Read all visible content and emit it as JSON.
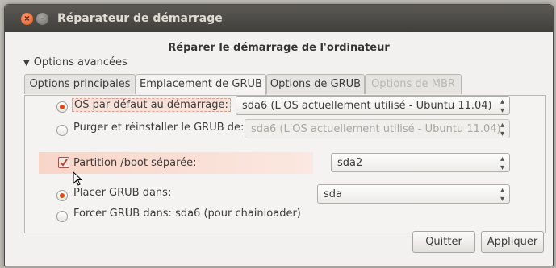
{
  "window": {
    "title": "Réparateur de démarrage"
  },
  "heading": "Réparer le démarrage de l'ordinateur",
  "expander": {
    "label": "Options avancées"
  },
  "tabs": [
    {
      "label": "Options principales",
      "state": "normal"
    },
    {
      "label": "Emplacement de GRUB",
      "state": "active"
    },
    {
      "label": "Options de GRUB",
      "state": "normal"
    },
    {
      "label": "Options de MBR",
      "state": "disabled"
    }
  ],
  "options": {
    "default_os": {
      "label": "OS par défaut au démarrage:",
      "selected": true,
      "value": "sda6 (L'OS actuellement utilisé - Ubuntu 11.04)"
    },
    "purge_grub": {
      "label": "Purger et réinstaller le GRUB de:",
      "selected": false,
      "value": "sda6 (L'OS actuellement utilisé - Ubuntu 11.04)"
    },
    "separate_boot": {
      "label": "Partition /boot séparée:",
      "checked": true,
      "value": "sda2"
    },
    "place_grub": {
      "label": "Placer GRUB dans:",
      "selected": true,
      "value": "sda"
    },
    "force_grub": {
      "label": "Forcer GRUB dans: sda6 (pour chainloader)",
      "selected": false
    }
  },
  "buttons": {
    "quit": "Quitter",
    "apply": "Appliquer"
  },
  "colors": {
    "accent": "#dd4814",
    "titlebar": "#403f3b",
    "highlight": "#f9d5c8"
  }
}
